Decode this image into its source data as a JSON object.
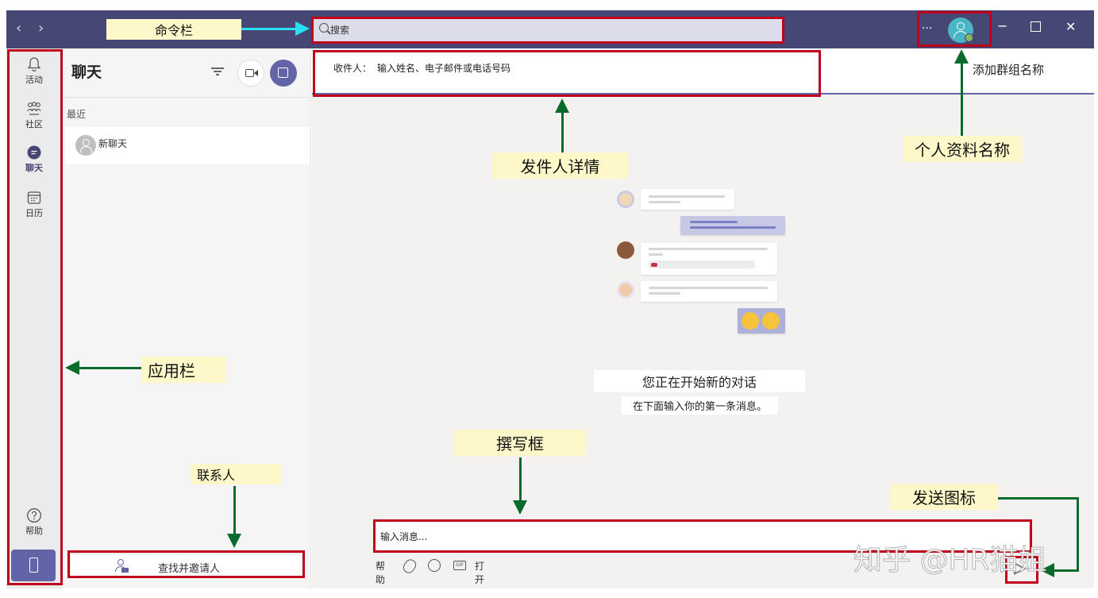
{
  "titlebar": {
    "back_icon": "chevron-left-icon",
    "forward_icon": "chevron-right-icon",
    "search_placeholder": "搜索",
    "more_label": "···",
    "minimize_label": "−",
    "close_label": "✕",
    "background_color": "#464775"
  },
  "appbar": {
    "items": [
      {
        "label": "活动",
        "icon": "bell-icon"
      },
      {
        "label": "社区",
        "icon": "people-icon"
      },
      {
        "label": "聊天",
        "icon": "chat-icon"
      },
      {
        "label": "日历",
        "icon": "calendar-icon"
      }
    ],
    "help_label": "帮助",
    "phone_icon": "phone-icon"
  },
  "chatlist": {
    "title": "聊天",
    "recent_label": "最近",
    "rows": [
      {
        "name": "新聊天"
      }
    ],
    "invite_label": "查找并邀请人"
  },
  "main": {
    "to_label": "收件人：",
    "to_placeholder": "输入姓名、电子邮件或电话号码",
    "group_name": "添加群组名称",
    "start_title": "您正在开始新的对话",
    "start_subtitle": "在下面输入你的第一条消息。",
    "compose_placeholder": "输入消息...",
    "toolbar": {
      "help": "帮助",
      "open": "打开",
      "gif": "GIF"
    },
    "accent_color": "#6264a7"
  },
  "annotations": {
    "command_bar": "命令栏",
    "sender_details": "发件人详情",
    "profile_name": "个人资料名称",
    "app_bar": "应用栏",
    "contacts": "联系人",
    "compose_box": "撰写框",
    "send_icon": "发送图标",
    "box_color": "#c0001a",
    "arrow_color": "#0b6b2d"
  },
  "watermark": "知乎 @HR猫姐"
}
